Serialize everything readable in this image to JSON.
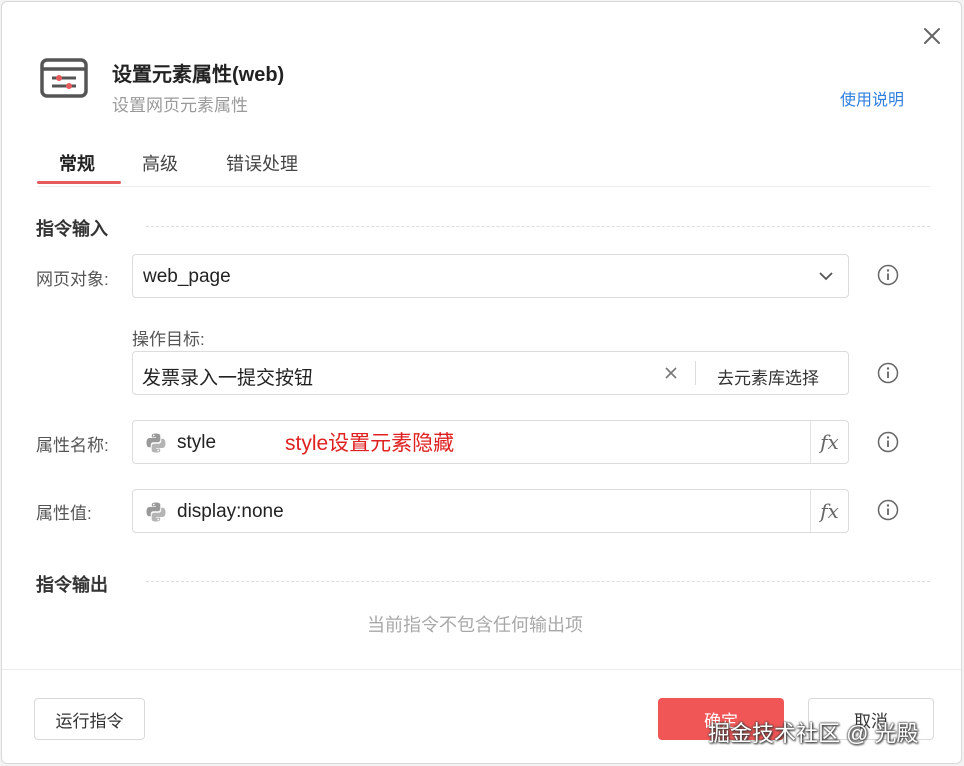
{
  "dialog": {
    "title": "设置元素属性(web)",
    "subtitle": "设置网页元素属性",
    "help_link": "使用说明"
  },
  "tabs": [
    {
      "label": "常规",
      "active": true
    },
    {
      "label": "高级",
      "active": false
    },
    {
      "label": "错误处理",
      "active": false
    }
  ],
  "input_section": {
    "title": "指令输入",
    "web_object": {
      "label": "网页对象:",
      "value": "web_page"
    },
    "target": {
      "label": "操作目标:",
      "value": "发票录入一提交按钮",
      "picker_label": "去元素库选择"
    },
    "attr_name": {
      "label": "属性名称:",
      "value": "style",
      "annotation": "style设置元素隐藏"
    },
    "attr_value": {
      "label": "属性值:",
      "value": "display:none"
    }
  },
  "output_section": {
    "title": "指令输出",
    "empty_message": "当前指令不包含任何输出项"
  },
  "footer": {
    "run_label": "运行指令",
    "ok_label": "确定",
    "cancel_label": "取消"
  },
  "watermark": "掘金技术社区 @ 光殿",
  "colors": {
    "accent": "#e55a5a",
    "primary_button": "#f05656",
    "link": "#2f7fe0",
    "annotation": "#e02020"
  },
  "icons": {
    "header": "settings-window-icon",
    "close": "close-icon",
    "dropdown": "chevron-down-icon",
    "clear": "clear-icon",
    "info": "info-icon",
    "python": "python-icon"
  }
}
